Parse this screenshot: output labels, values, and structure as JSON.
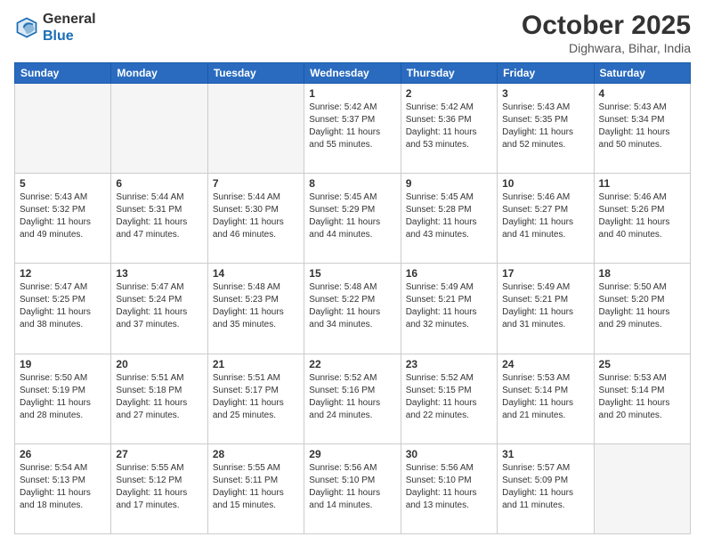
{
  "header": {
    "logo_general": "General",
    "logo_blue": "Blue",
    "month_title": "October 2025",
    "location": "Dighwara, Bihar, India"
  },
  "days_of_week": [
    "Sunday",
    "Monday",
    "Tuesday",
    "Wednesday",
    "Thursday",
    "Friday",
    "Saturday"
  ],
  "weeks": [
    [
      {
        "num": "",
        "info": ""
      },
      {
        "num": "",
        "info": ""
      },
      {
        "num": "",
        "info": ""
      },
      {
        "num": "1",
        "info": "Sunrise: 5:42 AM\nSunset: 5:37 PM\nDaylight: 11 hours\nand 55 minutes."
      },
      {
        "num": "2",
        "info": "Sunrise: 5:42 AM\nSunset: 5:36 PM\nDaylight: 11 hours\nand 53 minutes."
      },
      {
        "num": "3",
        "info": "Sunrise: 5:43 AM\nSunset: 5:35 PM\nDaylight: 11 hours\nand 52 minutes."
      },
      {
        "num": "4",
        "info": "Sunrise: 5:43 AM\nSunset: 5:34 PM\nDaylight: 11 hours\nand 50 minutes."
      }
    ],
    [
      {
        "num": "5",
        "info": "Sunrise: 5:43 AM\nSunset: 5:32 PM\nDaylight: 11 hours\nand 49 minutes."
      },
      {
        "num": "6",
        "info": "Sunrise: 5:44 AM\nSunset: 5:31 PM\nDaylight: 11 hours\nand 47 minutes."
      },
      {
        "num": "7",
        "info": "Sunrise: 5:44 AM\nSunset: 5:30 PM\nDaylight: 11 hours\nand 46 minutes."
      },
      {
        "num": "8",
        "info": "Sunrise: 5:45 AM\nSunset: 5:29 PM\nDaylight: 11 hours\nand 44 minutes."
      },
      {
        "num": "9",
        "info": "Sunrise: 5:45 AM\nSunset: 5:28 PM\nDaylight: 11 hours\nand 43 minutes."
      },
      {
        "num": "10",
        "info": "Sunrise: 5:46 AM\nSunset: 5:27 PM\nDaylight: 11 hours\nand 41 minutes."
      },
      {
        "num": "11",
        "info": "Sunrise: 5:46 AM\nSunset: 5:26 PM\nDaylight: 11 hours\nand 40 minutes."
      }
    ],
    [
      {
        "num": "12",
        "info": "Sunrise: 5:47 AM\nSunset: 5:25 PM\nDaylight: 11 hours\nand 38 minutes."
      },
      {
        "num": "13",
        "info": "Sunrise: 5:47 AM\nSunset: 5:24 PM\nDaylight: 11 hours\nand 37 minutes."
      },
      {
        "num": "14",
        "info": "Sunrise: 5:48 AM\nSunset: 5:23 PM\nDaylight: 11 hours\nand 35 minutes."
      },
      {
        "num": "15",
        "info": "Sunrise: 5:48 AM\nSunset: 5:22 PM\nDaylight: 11 hours\nand 34 minutes."
      },
      {
        "num": "16",
        "info": "Sunrise: 5:49 AM\nSunset: 5:21 PM\nDaylight: 11 hours\nand 32 minutes."
      },
      {
        "num": "17",
        "info": "Sunrise: 5:49 AM\nSunset: 5:21 PM\nDaylight: 11 hours\nand 31 minutes."
      },
      {
        "num": "18",
        "info": "Sunrise: 5:50 AM\nSunset: 5:20 PM\nDaylight: 11 hours\nand 29 minutes."
      }
    ],
    [
      {
        "num": "19",
        "info": "Sunrise: 5:50 AM\nSunset: 5:19 PM\nDaylight: 11 hours\nand 28 minutes."
      },
      {
        "num": "20",
        "info": "Sunrise: 5:51 AM\nSunset: 5:18 PM\nDaylight: 11 hours\nand 27 minutes."
      },
      {
        "num": "21",
        "info": "Sunrise: 5:51 AM\nSunset: 5:17 PM\nDaylight: 11 hours\nand 25 minutes."
      },
      {
        "num": "22",
        "info": "Sunrise: 5:52 AM\nSunset: 5:16 PM\nDaylight: 11 hours\nand 24 minutes."
      },
      {
        "num": "23",
        "info": "Sunrise: 5:52 AM\nSunset: 5:15 PM\nDaylight: 11 hours\nand 22 minutes."
      },
      {
        "num": "24",
        "info": "Sunrise: 5:53 AM\nSunset: 5:14 PM\nDaylight: 11 hours\nand 21 minutes."
      },
      {
        "num": "25",
        "info": "Sunrise: 5:53 AM\nSunset: 5:14 PM\nDaylight: 11 hours\nand 20 minutes."
      }
    ],
    [
      {
        "num": "26",
        "info": "Sunrise: 5:54 AM\nSunset: 5:13 PM\nDaylight: 11 hours\nand 18 minutes."
      },
      {
        "num": "27",
        "info": "Sunrise: 5:55 AM\nSunset: 5:12 PM\nDaylight: 11 hours\nand 17 minutes."
      },
      {
        "num": "28",
        "info": "Sunrise: 5:55 AM\nSunset: 5:11 PM\nDaylight: 11 hours\nand 15 minutes."
      },
      {
        "num": "29",
        "info": "Sunrise: 5:56 AM\nSunset: 5:10 PM\nDaylight: 11 hours\nand 14 minutes."
      },
      {
        "num": "30",
        "info": "Sunrise: 5:56 AM\nSunset: 5:10 PM\nDaylight: 11 hours\nand 13 minutes."
      },
      {
        "num": "31",
        "info": "Sunrise: 5:57 AM\nSunset: 5:09 PM\nDaylight: 11 hours\nand 11 minutes."
      },
      {
        "num": "",
        "info": ""
      }
    ]
  ]
}
